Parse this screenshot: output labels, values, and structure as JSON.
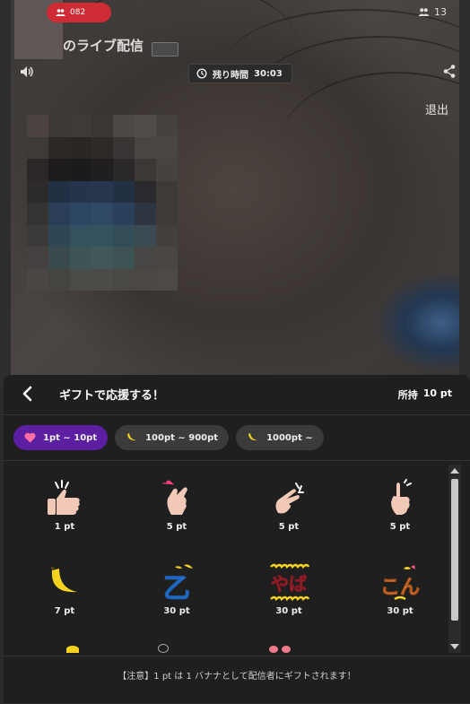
{
  "stream": {
    "viewer_badge": "082",
    "title": "のライブ配信",
    "people_count": "13",
    "timer_label": "残り時間",
    "timer_value": "30:03",
    "exit_label": "退出"
  },
  "gift_panel": {
    "title": "ギフトで応援する！",
    "points_label": "所持",
    "points_value": "10 pt",
    "tabs": [
      {
        "label": "1pt ~ 10pt",
        "icon": "heart-icon",
        "active": true
      },
      {
        "label": "100pt ~ 900pt",
        "icon": "banana-icon",
        "active": false
      },
      {
        "label": "1000pt ~",
        "icon": "banana-icon",
        "active": false
      }
    ],
    "gifts": [
      {
        "icon": "thumbs-up-icon",
        "price": "1 pt"
      },
      {
        "icon": "finger-heart-icon",
        "price": "5 pt"
      },
      {
        "icon": "finger-snap-icon",
        "price": "5 pt"
      },
      {
        "icon": "pointing-up-icon",
        "price": "5 pt"
      },
      {
        "icon": "banana-icon",
        "price": "7 pt"
      },
      {
        "icon": "otsu-text-icon",
        "price": "30 pt"
      },
      {
        "icon": "yaba-text-icon",
        "price": "30 pt"
      },
      {
        "icon": "kon-text-icon",
        "price": "30 pt"
      }
    ],
    "gift_text": {
      "otsu": "乙",
      "yaba": "やば",
      "kon": "こん"
    },
    "notice": "【注意】1 pt は 1 バナナとして配信者にギフトされます！"
  },
  "colors": {
    "accent_purple": "#5c1fa2",
    "badge_red": "#cf2b35",
    "banana_yellow": "#f4d21f",
    "panel_bg": "#1f1f1f"
  }
}
